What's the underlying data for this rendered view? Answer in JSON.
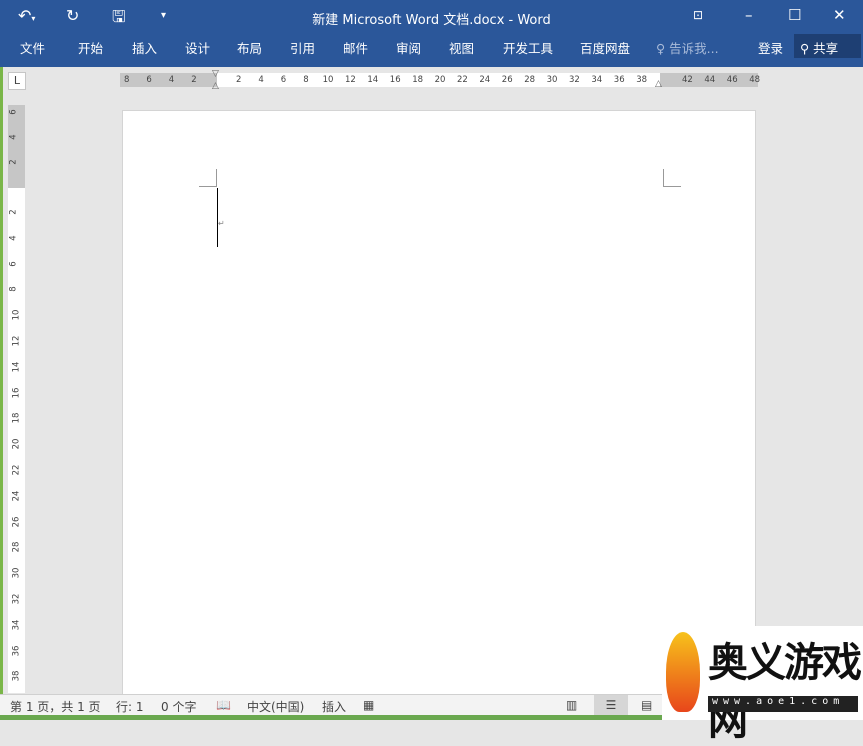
{
  "titlebar": {
    "title": "新建 Microsoft Word 文档.docx - Word",
    "qa_icons": [
      "undo-icon",
      "redo-icon",
      "save-icon",
      "customize-icon"
    ],
    "window_icons": [
      "ribbon-display-icon",
      "minimize-icon",
      "maximize-icon",
      "close-icon"
    ]
  },
  "ribbon": {
    "tabs": [
      "文件",
      "开始",
      "插入",
      "设计",
      "布局",
      "引用",
      "邮件",
      "审阅",
      "视图",
      "开发工具",
      "百度网盘"
    ],
    "tell_me": "告诉我...",
    "login": "登录",
    "share": "共享"
  },
  "ruler": {
    "corner": "L",
    "h_left": [
      "8",
      "6",
      "4",
      "2"
    ],
    "h_main": [
      "2",
      "4",
      "6",
      "8",
      "10",
      "12",
      "14",
      "16",
      "18",
      "20",
      "22",
      "24",
      "26",
      "28",
      "30",
      "32",
      "34",
      "36",
      "38"
    ],
    "h_right": [
      "42",
      "44",
      "46",
      "48"
    ],
    "v_top": [
      "6",
      "4",
      "2"
    ],
    "v_main": [
      "2",
      "4",
      "6",
      "8",
      "10",
      "12",
      "14",
      "16",
      "18",
      "20",
      "22",
      "24",
      "26",
      "28",
      "30",
      "32",
      "34",
      "36",
      "38"
    ]
  },
  "status": {
    "page": "第 1 页，共 1 页",
    "line": "行: 1",
    "words": "0 个字",
    "language": "中文(中国)",
    "mode": "插入"
  },
  "watermark": {
    "text": "奥义游戏网",
    "url": "www.aoe1.com"
  },
  "colors": {
    "accent": "#2b579a"
  }
}
